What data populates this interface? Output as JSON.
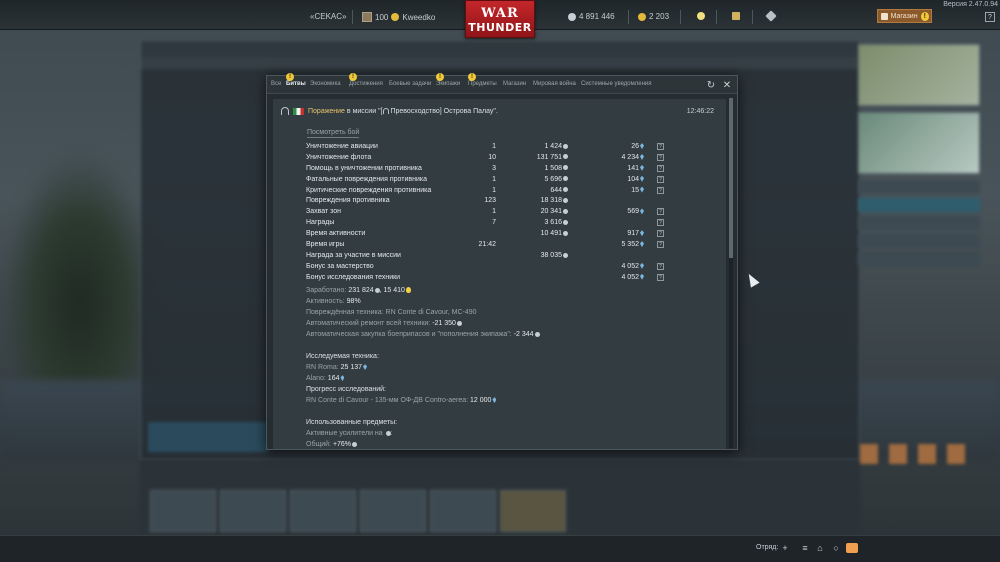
{
  "topbar": {
    "version": "Версия 2.47.0.94",
    "squadron_tag": "«CEKAC»",
    "level": "100",
    "nickname": "Kweedko",
    "silver_lions": "4 891 446",
    "gold_eagles": "2 203",
    "logo_line1": "WAR",
    "logo_line2": "THUNDER",
    "shop_label": "Магазин",
    "shop_badge": "!",
    "help": "?"
  },
  "window": {
    "tabs": [
      {
        "label": "Все",
        "active": false,
        "badge": ""
      },
      {
        "label": "Битвы",
        "active": true,
        "badge": "!"
      },
      {
        "label": "Экономика",
        "active": false,
        "badge": ""
      },
      {
        "label": "Достижения",
        "active": false,
        "badge": "!"
      },
      {
        "label": "Боевые задачи",
        "active": false,
        "badge": ""
      },
      {
        "label": "Экипажи",
        "active": false,
        "badge": "!"
      },
      {
        "label": "Предметы",
        "active": false,
        "badge": "!"
      },
      {
        "label": "Магазин",
        "active": false,
        "badge": ""
      },
      {
        "label": "Мировая война",
        "active": false,
        "badge": ""
      },
      {
        "label": "Системные уведомления",
        "active": false,
        "badge": ""
      }
    ],
    "refresh_icon": "refresh-icon",
    "close_icon": "close-icon"
  },
  "message": {
    "result": "Поражение",
    "mission_text": " в миссии \"[",
    "mission_mode": " Превосходство] Острова Палау\".",
    "time": "12:46:22",
    "view_battle": "Посмотреть бой",
    "rows": [
      {
        "name": "Уничтожение авиации",
        "count": "1",
        "sl": "1 424",
        "rp": "26",
        "q": "?"
      },
      {
        "name": "Уничтожение флота",
        "count": "10",
        "sl": "131 751",
        "rp": "4 234",
        "q": "?"
      },
      {
        "name": "Помощь в уничтожении противника",
        "count": "3",
        "sl": "1 508",
        "rp": "141",
        "q": "?"
      },
      {
        "name": "Фатальные повреждения противника",
        "count": "1",
        "sl": "5 696",
        "rp": "104",
        "q": "?"
      },
      {
        "name": "Критические повреждения противника",
        "count": "1",
        "sl": "644",
        "rp": "15",
        "q": "?"
      },
      {
        "name": "Повреждения противника",
        "count": "123",
        "sl": "18 318",
        "rp": "",
        "q": ""
      },
      {
        "name": "Захват зон",
        "count": "1",
        "sl": "20 341",
        "rp": "569",
        "q": "?"
      },
      {
        "name": "Награды",
        "count": "7",
        "sl": "3 616",
        "rp": "",
        "q": "?"
      },
      {
        "name": "Время активности",
        "count": "",
        "sl": "10 491",
        "rp": "917",
        "q": "?"
      },
      {
        "name": "Время игры",
        "count": "21:42",
        "sl": "",
        "rp": "5 352",
        "q": "?"
      },
      {
        "name": "Награда за участие в миссии",
        "count": "",
        "sl": "38 035",
        "rp": "",
        "q": ""
      },
      {
        "name": "Бонус за мастерство",
        "count": "",
        "sl": "",
        "rp": "4 052",
        "q": "?"
      },
      {
        "name": "Бонус исследования техники",
        "count": "",
        "sl": "",
        "rp": "4 052",
        "q": "?"
      }
    ],
    "earned_label": "Заработано: ",
    "earned_sl": "231 824",
    "earned_sep": ", ",
    "earned_rp": "15 410",
    "activity_label": "Активность: ",
    "activity_value": "98%",
    "damaged_label": "Повреждённая техника: ",
    "damaged_value": "RN Conte di Cavour, MC-490",
    "repair_label": "Автоматический ремонт всей техники: ",
    "repair_value": "-21 350",
    "ammo_label": "Автоматическая закупка боеприпасов и \"пополнения экипажа\": ",
    "ammo_value": "-2 344",
    "research_header": "Исследуемая техника:",
    "research_1_label": "RN Roma: ",
    "research_1_value": "25 137",
    "research_2_label": "Alano: ",
    "research_2_value": "164",
    "progress_header": "Прогресс исследований:",
    "progress_label": "RN Conte di Cavour - 135-мм ОФ-ДВ Contro-aerea: ",
    "progress_value": "12 000",
    "used_header": "Использованные предметы:",
    "boosters_label": "Активные усилители на ",
    "boosters_suffix": ":",
    "total_label": "Общий: ",
    "total_value": "+76%"
  },
  "bottom": {
    "squad_label": "Отряд:"
  },
  "colors": {
    "defeat": "#e9c46a",
    "rp": "#7ab6e0",
    "gold": "#f0d040",
    "logo_red": "#c4262a"
  }
}
